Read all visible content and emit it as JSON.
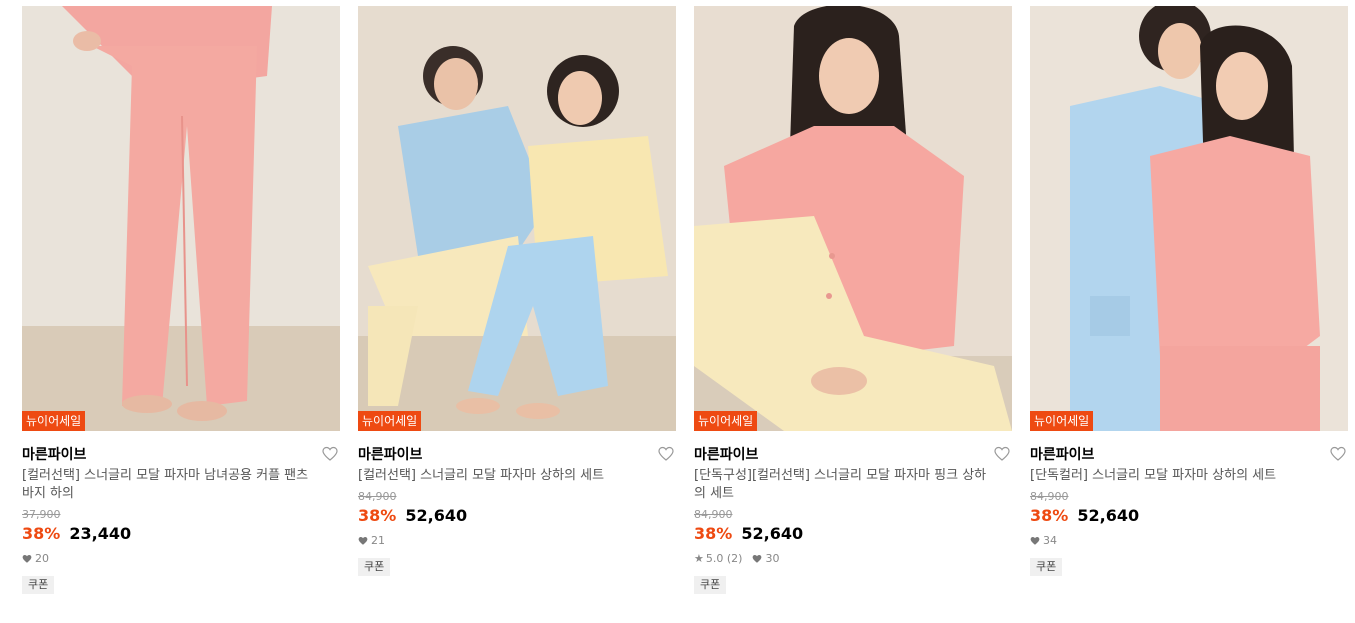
{
  "colors": {
    "accent": "#ee4a12",
    "muted": "#999999",
    "text": "#000000"
  },
  "products": [
    {
      "badge": "뉴이어세일",
      "brand": "마른파이브",
      "title": "[컬러선택] 스너글리 모달 파자마 남녀공용 커플 팬츠 바지 하의",
      "original_price": "37,900",
      "discount": "38%",
      "price": "23,440",
      "rating": "",
      "likes": "20",
      "coupon": "쿠폰"
    },
    {
      "badge": "뉴이어세일",
      "brand": "마른파이브",
      "title": "[컬러선택] 스너글리 모달 파자마 상하의 세트",
      "original_price": "84,900",
      "discount": "38%",
      "price": "52,640",
      "rating": "",
      "likes": "21",
      "coupon": "쿠폰"
    },
    {
      "badge": "뉴이어세일",
      "brand": "마른파이브",
      "title": "[단독구성][컬러선택] 스너글리 모달 파자마 핑크 상하의 세트",
      "original_price": "84,900",
      "discount": "38%",
      "price": "52,640",
      "rating": "5.0 (2)",
      "likes": "30",
      "coupon": "쿠폰"
    },
    {
      "badge": "뉴이어세일",
      "brand": "마른파이브",
      "title": "[단독컬러] 스너글리 모달 파자마 상하의 세트",
      "original_price": "84,900",
      "discount": "38%",
      "price": "52,640",
      "rating": "",
      "likes": "34",
      "coupon": "쿠폰"
    }
  ]
}
